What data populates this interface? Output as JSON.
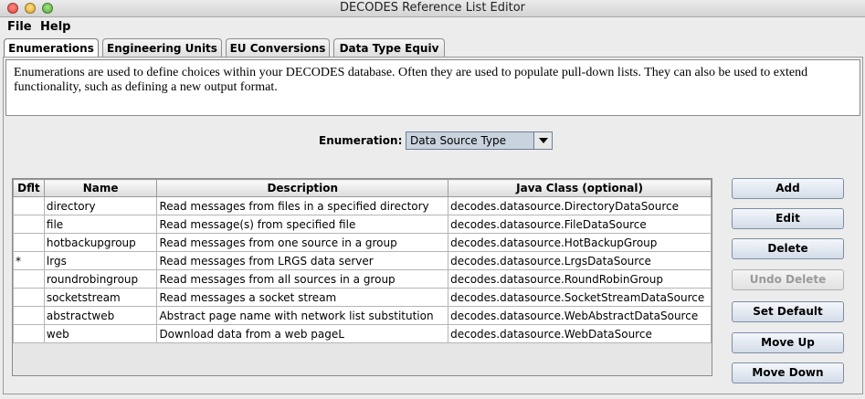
{
  "window": {
    "title": "DECODES Reference List Editor"
  },
  "menu": {
    "file": "File",
    "help": "Help"
  },
  "tabs": [
    {
      "label": "Enumerations",
      "active": true
    },
    {
      "label": "Engineering Units",
      "active": false
    },
    {
      "label": "EU Conversions",
      "active": false
    },
    {
      "label": "Data Type Equiv",
      "active": false
    }
  ],
  "description": "Enumerations are used to define choices within your DECODES database. Often they are used to populate pull-down lists. They can also be used to extend functionality, such as defining a new output format.",
  "enumeration": {
    "label": "Enumeration:",
    "selected": "Data Source Type"
  },
  "table": {
    "headers": [
      "Dflt",
      "Name",
      "Description",
      "Java Class (optional)"
    ],
    "rows": [
      {
        "dflt": "",
        "name": "directory",
        "description": "Read messages from files in a specified directory",
        "java_class": "decodes.datasource.DirectoryDataSource"
      },
      {
        "dflt": "",
        "name": "file",
        "description": "Read message(s) from specified file",
        "java_class": "decodes.datasource.FileDataSource"
      },
      {
        "dflt": "",
        "name": "hotbackupgroup",
        "description": "Read messages from one source in a group",
        "java_class": "decodes.datasource.HotBackupGroup"
      },
      {
        "dflt": "*",
        "name": "lrgs",
        "description": "Read messages from LRGS data server",
        "java_class": "decodes.datasource.LrgsDataSource"
      },
      {
        "dflt": "",
        "name": "roundrobingroup",
        "description": "Read messages from all sources in a group",
        "java_class": "decodes.datasource.RoundRobinGroup"
      },
      {
        "dflt": "",
        "name": "socketstream",
        "description": "Read messages a socket stream",
        "java_class": "decodes.datasource.SocketStreamDataSource"
      },
      {
        "dflt": "",
        "name": "abstractweb",
        "description": "Abstract page name with network list substitution",
        "java_class": "decodes.datasource.WebAbstractDataSource"
      },
      {
        "dflt": "",
        "name": "web",
        "description": "Download data from a web pageL",
        "java_class": "decodes.datasource.WebDataSource"
      }
    ]
  },
  "buttons": {
    "add": "Add",
    "edit": "Edit",
    "delete": "Delete",
    "undo_delete": "Undo Delete",
    "set_default": "Set Default",
    "move_up": "Move Up",
    "move_down": "Move Down"
  }
}
